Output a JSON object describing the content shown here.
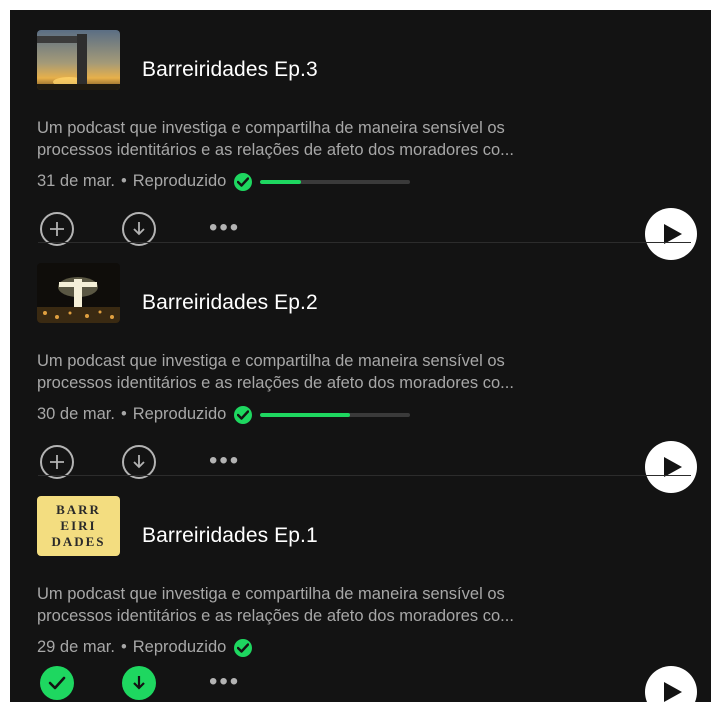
{
  "episodes": [
    {
      "title": "Barreiridades Ep.3",
      "description_line1": "Um podcast que investiga e compartilha de maneira sensível os",
      "description_line2": "processos identitários e as relações de afeto dos moradores co...",
      "date": "31 de mar.",
      "separator": "•",
      "status": "Reproduzido",
      "progress": 0.27,
      "saved": false,
      "downloaded": false,
      "thumbnail": "statue-sunset-image"
    },
    {
      "title": "Barreiridades Ep.2",
      "description_line1": "Um podcast que investiga e compartilha de maneira sensível os",
      "description_line2": "processos identitários e as relações de afeto dos moradores co...",
      "date": "30 de mar.",
      "separator": "•",
      "status": "Reproduzido",
      "progress": 0.6,
      "saved": false,
      "downloaded": false,
      "thumbnail": "statue-night-image"
    },
    {
      "title": "Barreiridades Ep.1",
      "description_line1": "Um podcast que investiga e compartilha de maneira sensível os",
      "description_line2": "processos identitários e as relações de afeto dos moradores co...",
      "date": "29 de mar.",
      "separator": "•",
      "status": "Reproduzido",
      "progress": null,
      "saved": true,
      "downloaded": true,
      "thumbnail": "barreiridades-logo",
      "logo_text": [
        "BARR",
        "EIRI",
        "DADES"
      ]
    }
  ],
  "more_label": "•••",
  "colors": {
    "background": "#131313",
    "accent": "#1ed760",
    "text_primary": "#ffffff",
    "text_secondary": "#a7a7a7"
  }
}
